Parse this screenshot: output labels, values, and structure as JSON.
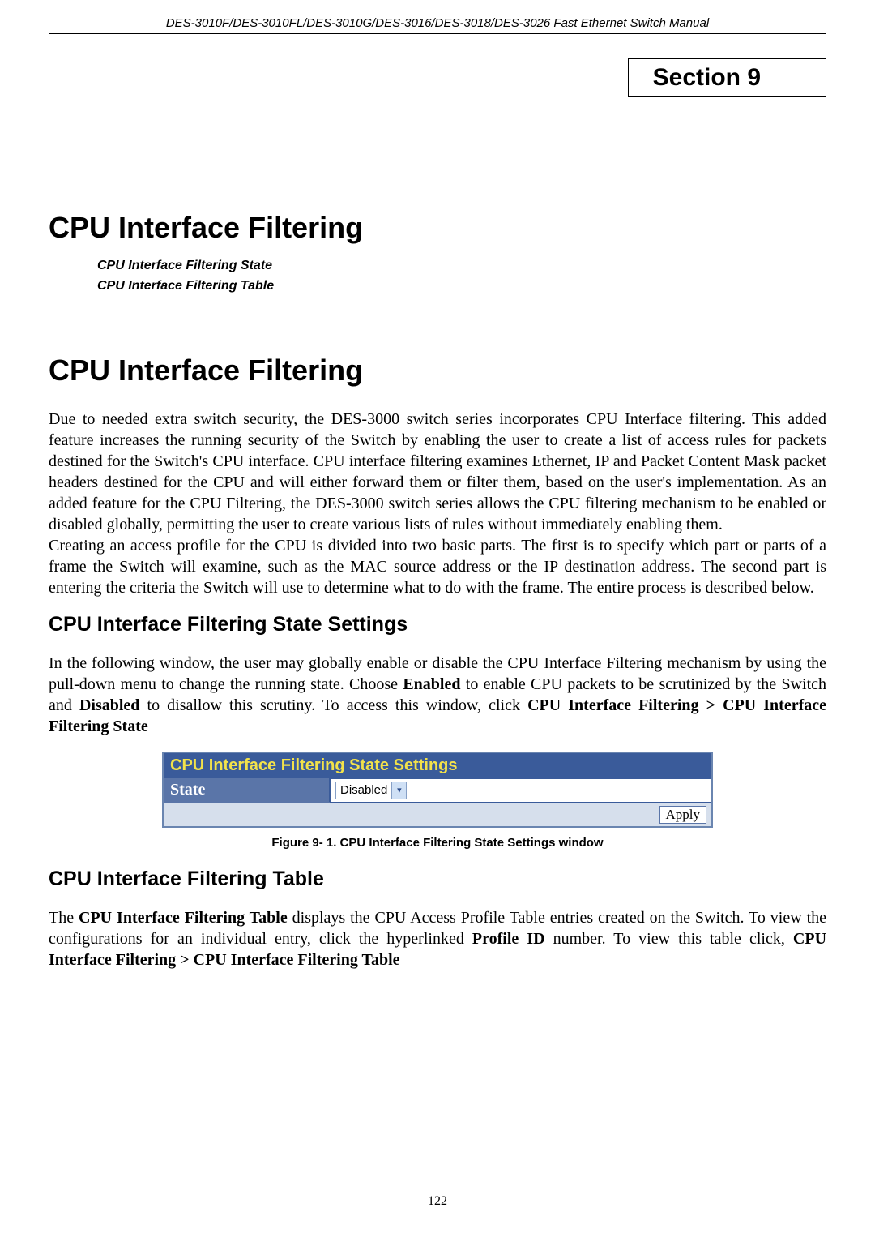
{
  "header": "DES-3010F/DES-3010FL/DES-3010G/DES-3016/DES-3018/DES-3026 Fast Ethernet Switch Manual",
  "section_label": "Section 9",
  "title1": "CPU Interface Filtering",
  "toc": {
    "item1": "CPU Interface Filtering State",
    "item2": "CPU Interface Filtering Table"
  },
  "title2": "CPU Interface Filtering",
  "para1": "Due to needed extra switch security, the DES-3000 switch series incorporates CPU Interface filtering. This added feature increases the running security of the Switch by enabling the user to create a list of access rules for packets destined for the Switch's CPU interface. CPU interface filtering examines Ethernet, IP and Packet Content Mask packet headers destined for the CPU and will either forward them or filter them, based on the user's implementation. As an added feature for the CPU Filtering, the DES-3000 switch series allows the CPU filtering mechanism to be enabled or disabled globally, permitting the user to create various lists of rules without immediately enabling them.",
  "para2": "Creating an access profile for the CPU is divided into two basic parts. The first is to specify which part or parts of a frame the Switch will examine, such as the MAC source address or the IP destination address. The second part is entering the criteria the Switch will use to determine what to do with the frame. The entire process is described below.",
  "subhead1": "CPU Interface Filtering State Settings",
  "para3_pre": "In the following window, the user may globally enable or disable the CPU Interface Filtering mechanism by using the pull-down menu to change the running state. Choose ",
  "para3_bold1": "Enabled",
  "para3_mid1": " to enable CPU packets to be scrutinized by the Switch and ",
  "para3_bold2": "Disabled",
  "para3_mid2": " to disallow this scrutiny. To access this window, click ",
  "para3_bold3": "CPU Interface Filtering > CPU Interface Filtering State",
  "ui": {
    "title": "CPU Interface Filtering State Settings",
    "row_label": "State",
    "select_value": "Disabled",
    "apply_label": "Apply"
  },
  "figure_caption": "Figure 9- 1. CPU Interface Filtering State Settings window",
  "subhead2": "CPU Interface Filtering Table",
  "para4_pre": "The ",
  "para4_bold1": "CPU Interface Filtering Table",
  "para4_mid1": " displays the CPU Access Profile Table entries created on the Switch. To view the configurations for an individual entry, click the hyperlinked ",
  "para4_bold2": "Profile ID",
  "para4_mid2": " number. To view this table click, ",
  "para4_bold3": "CPU Interface Filtering > CPU Interface Filtering Table",
  "page_number": "122"
}
